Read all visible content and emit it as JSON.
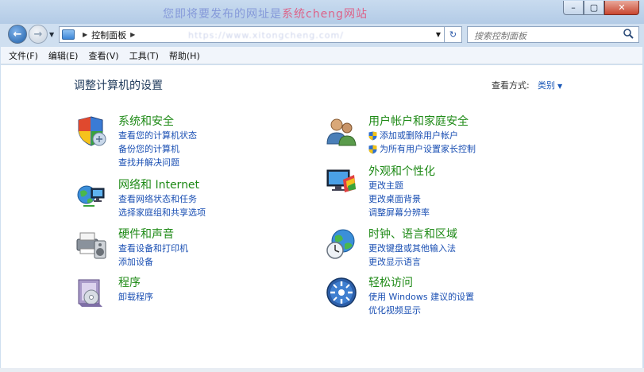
{
  "window": {
    "watermark_a": "您即将要发布的网址是",
    "watermark_b": "系统cheng网站",
    "controls": {
      "minimize": "–",
      "maximize": "▢",
      "close": "✕"
    }
  },
  "navbar": {
    "breadcrumb": "控制面板",
    "address_overlay": "https://www.xitongcheng.com/",
    "search_placeholder": "搜索控制面板"
  },
  "menu": [
    "文件(F)",
    "编辑(E)",
    "查看(V)",
    "工具(T)",
    "帮助(H)"
  ],
  "page": {
    "title": "调整计算机的设置",
    "view_by_label": "查看方式:",
    "view_by_value": "类别"
  },
  "categories": {
    "system": {
      "title": "系统和安全",
      "links": [
        "查看您的计算机状态",
        "备份您的计算机",
        "查找并解决问题"
      ]
    },
    "network": {
      "title": "网络和 Internet",
      "links": [
        "查看网络状态和任务",
        "选择家庭组和共享选项"
      ]
    },
    "hardware": {
      "title": "硬件和声音",
      "links": [
        "查看设备和打印机",
        "添加设备"
      ]
    },
    "programs": {
      "title": "程序",
      "links": [
        "卸载程序"
      ]
    },
    "users": {
      "title": "用户帐户和家庭安全",
      "links": [
        "添加或删除用户帐户",
        "为所有用户设置家长控制"
      ]
    },
    "appearance": {
      "title": "外观和个性化",
      "links": [
        "更改主题",
        "更改桌面背景",
        "调整屏幕分辨率"
      ]
    },
    "clock": {
      "title": "时钟、语言和区域",
      "links": [
        "更改键盘或其他输入法",
        "更改显示语言"
      ]
    },
    "ease": {
      "title": "轻松访问",
      "links": [
        "使用 Windows 建议的设置",
        "优化视频显示"
      ]
    }
  },
  "icons": {
    "back": "back-arrow-icon",
    "forward": "forward-arrow-icon",
    "search": "magnifier-icon",
    "refresh": "refresh-icon"
  },
  "colors": {
    "category_title": "#1e8a16",
    "link": "#1a4fb3",
    "page_title": "#1e395b",
    "close_button": "#c8452f"
  }
}
